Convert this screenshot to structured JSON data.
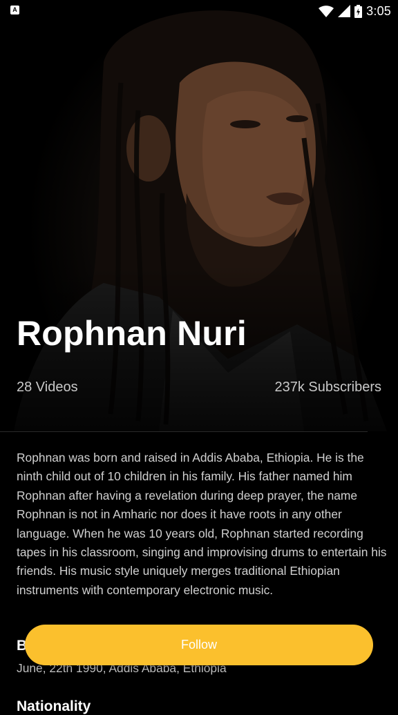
{
  "status_bar": {
    "time": "3:05",
    "left_icon_letter": "A",
    "icons": [
      "wifi-icon",
      "signal-icon",
      "battery-icon"
    ]
  },
  "artist": {
    "name": "Rophnan Nuri",
    "videos": "28 Videos",
    "subscribers": "237k Subscribers"
  },
  "bio": "Rophnan was born and raised in Addis Ababa, Ethiopia. He is the ninth child out of 10 children in his family. His father named him Rophnan after having a revelation during deep prayer, the name Rophnan is not in Amharic nor does it have roots in any other language. When he was 10 years old, Rophnan started recording tapes in his classroom, singing and improvising drums to entertain his friends. His music style uniquely merges traditional Ethiopian instruments with contemporary electronic music.",
  "details": {
    "birth_heading": "Birth",
    "birth_value": "June, 22th 1990, Addis Ababa, Ethiopia",
    "nationality_heading": "Nationality"
  },
  "follow_button": {
    "label": "Follow"
  },
  "colors": {
    "accent": "#fbc02d",
    "background": "#000000"
  }
}
